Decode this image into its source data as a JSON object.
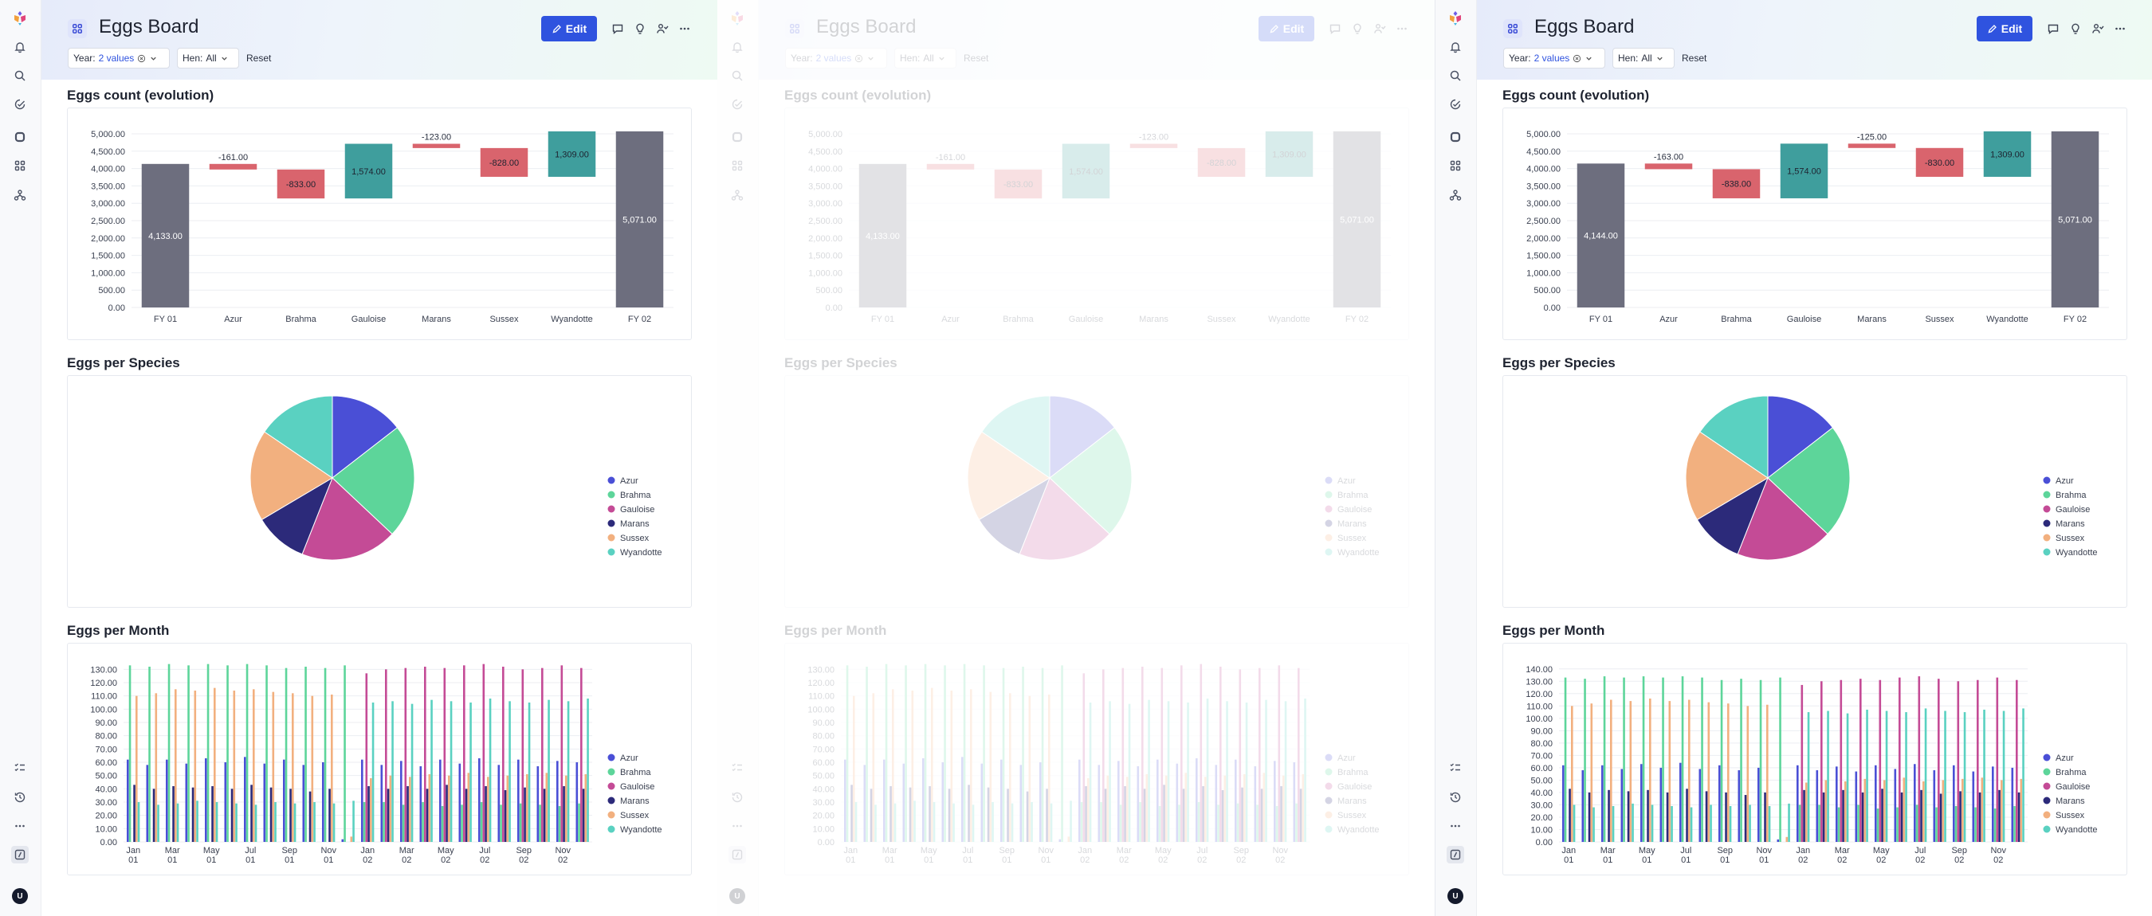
{
  "board": {
    "title": "Eggs Board",
    "edit_label": "Edit"
  },
  "filters": {
    "year_label": "Year:",
    "year_value": "2 values",
    "hen_label": "Hen:",
    "hen_value": "All",
    "reset_label": "Reset"
  },
  "sections": {
    "count_title": "Eggs count (evolution)",
    "species_title": "Eggs per Species",
    "month_title": "Eggs per Month"
  },
  "user_initial": "U",
  "colors": {
    "accent": "#2f53df",
    "total": "#6d6e7e",
    "increase": "#3f9e9d",
    "decrease": "#d9646d"
  },
  "icons": [
    "logo-icon",
    "bell-icon",
    "search-icon",
    "check-circle-icon",
    "square-icon",
    "apps-grid-icon",
    "org-chart-icon",
    "checklist-icon",
    "history-icon",
    "more-icon",
    "sidebar-toggle-icon",
    "pencil-icon",
    "comment-icon",
    "lightbulb-icon",
    "users-icon",
    "ellipsis-icon",
    "dashboard-icon",
    "clear-icon",
    "chevron-down-icon"
  ],
  "chart_data": [
    {
      "type": "bar",
      "variant": "waterfall",
      "panel": "left",
      "title": "Eggs count (evolution)",
      "categories": [
        "FY 01",
        "Azur",
        "Brahma",
        "Gauloise",
        "Marans",
        "Sussex",
        "Wyandotte",
        "FY 02"
      ],
      "values": [
        4133,
        -161,
        -833,
        1574,
        -123,
        -828,
        1309,
        5071
      ],
      "labels": [
        "4,133.00",
        "-161.00",
        "-833.00",
        "1,574.00",
        "-123.00",
        "-828.00",
        "1,309.00",
        "5,071.00"
      ],
      "yticks": [
        "0.00",
        "500.00",
        "1,000.00",
        "1,500.00",
        "2,000.00",
        "2,500.00",
        "3,000.00",
        "3,500.00",
        "4,000.00",
        "4,500.00",
        "5,000.00"
      ],
      "ylim": [
        0,
        5000
      ]
    },
    {
      "type": "bar",
      "variant": "waterfall",
      "panel": "right",
      "title": "Eggs count (evolution)",
      "categories": [
        "FY 01",
        "Azur",
        "Brahma",
        "Gauloise",
        "Marans",
        "Sussex",
        "Wyandotte",
        "FY 02"
      ],
      "values": [
        4144,
        -163,
        -838,
        1574,
        -125,
        -830,
        1309,
        5071
      ],
      "labels": [
        "4,144.00",
        "-163.00",
        "-838.00",
        "1,574.00",
        "-125.00",
        "-830.00",
        "1,309.00",
        "5,071.00"
      ],
      "yticks": [
        "0.00",
        "500.00",
        "1,000.00",
        "1,500.00",
        "2,000.00",
        "2,500.00",
        "3,000.00",
        "3,500.00",
        "4,000.00",
        "4,500.00",
        "5,000.00"
      ],
      "ylim": [
        0,
        5000
      ]
    },
    {
      "type": "pie",
      "title": "Eggs per Species",
      "legend": [
        "Azur",
        "Brahma",
        "Gauloise",
        "Marans",
        "Sussex",
        "Wyandotte"
      ],
      "values": [
        14.5,
        22.5,
        19,
        10.5,
        18,
        15.5
      ],
      "colors": [
        "#4a4fd6",
        "#5dd59a",
        "#c44b96",
        "#2c2a7a",
        "#f2b07f",
        "#5ad1c1"
      ]
    },
    {
      "type": "bar",
      "panel": "left",
      "title": "Eggs per Month",
      "categories": [
        "Jan 01",
        "Feb 01",
        "Mar 01",
        "Apr 01",
        "May 01",
        "Jun 01",
        "Jul 01",
        "Aug 01",
        "Sep 01",
        "Oct 01",
        "Nov 01",
        "Dec 01",
        "Jan 02",
        "Feb 02",
        "Mar 02",
        "Apr 02",
        "May 02",
        "Jun 02",
        "Jul 02",
        "Aug 02",
        "Sep 02",
        "Oct 02",
        "Nov 02",
        "Dec 02"
      ],
      "tick_labels": [
        "Jan 01",
        "Mar 01",
        "May 01",
        "Jul 01",
        "Sep 01",
        "Nov 01",
        "Jan 02",
        "Mar 02",
        "May 02",
        "Jul 02",
        "Sep 02",
        "Nov 02"
      ],
      "yticks": [
        "0.00",
        "10.00",
        "20.00",
        "30.00",
        "40.00",
        "50.00",
        "60.00",
        "70.00",
        "80.00",
        "90.00",
        "100.00",
        "110.00",
        "120.00",
        "130.00"
      ],
      "ylim": [
        0,
        135
      ],
      "series": [
        {
          "name": "Azur",
          "color": "#4a4fd6",
          "values": [
            62,
            58,
            62,
            59,
            63,
            60,
            64,
            59,
            62,
            58,
            60,
            2,
            62,
            58,
            61,
            57,
            62,
            59,
            63,
            58,
            62,
            57,
            61,
            60
          ]
        },
        {
          "name": "Brahma",
          "color": "#5dd59a",
          "values": [
            133,
            132,
            134,
            133,
            134,
            133,
            134,
            133,
            131,
            132,
            131,
            133,
            30,
            30,
            28,
            30,
            27,
            28,
            30,
            28,
            29,
            28,
            27,
            29
          ]
        },
        {
          "name": "Gauloise",
          "color": "#c44b96",
          "values": [
            0,
            0,
            0,
            0,
            0,
            0,
            0,
            0,
            0,
            0,
            0,
            0,
            127,
            130,
            131,
            132,
            131,
            133,
            134,
            132,
            130,
            131,
            133,
            131
          ]
        },
        {
          "name": "Marans",
          "color": "#2c2a7a",
          "values": [
            43,
            40,
            42,
            41,
            42,
            40,
            43,
            41,
            40,
            38,
            40,
            0,
            42,
            40,
            42,
            40,
            43,
            40,
            42,
            39,
            41,
            40,
            42,
            40
          ]
        },
        {
          "name": "Sussex",
          "color": "#f2b07f",
          "values": [
            110,
            112,
            115,
            114,
            116,
            114,
            115,
            113,
            112,
            110,
            111,
            4,
            48,
            50,
            49,
            51,
            50,
            52,
            49,
            50,
            51,
            52,
            50,
            51
          ]
        },
        {
          "name": "Wyandotte",
          "color": "#5ad1c1",
          "values": [
            30,
            28,
            29,
            31,
            30,
            29,
            28,
            30,
            29,
            30,
            29,
            31,
            105,
            106,
            104,
            107,
            106,
            105,
            108,
            106,
            105,
            107,
            106,
            108
          ]
        }
      ]
    },
    {
      "type": "bar",
      "panel": "right",
      "title": "Eggs per Month",
      "categories": [
        "Jan 01",
        "Feb 01",
        "Mar 01",
        "Apr 01",
        "May 01",
        "Jun 01",
        "Jul 01",
        "Aug 01",
        "Sep 01",
        "Oct 01",
        "Nov 01",
        "Dec 01",
        "Jan 02",
        "Feb 02",
        "Mar 02",
        "Apr 02",
        "May 02",
        "Jun 02",
        "Jul 02",
        "Aug 02",
        "Sep 02",
        "Oct 02",
        "Nov 02",
        "Dec 02"
      ],
      "tick_labels": [
        "Jan 01",
        "Mar 01",
        "May 01",
        "Jul 01",
        "Sep 01",
        "Nov 01",
        "Jan 02",
        "Mar 02",
        "May 02",
        "Jul 02",
        "Sep 02",
        "Nov 02"
      ],
      "yticks": [
        "0.00",
        "10.00",
        "20.00",
        "30.00",
        "40.00",
        "50.00",
        "60.00",
        "70.00",
        "80.00",
        "90.00",
        "100.00",
        "110.00",
        "120.00",
        "130.00",
        "140.00"
      ],
      "ylim": [
        0,
        145
      ],
      "series": [
        {
          "name": "Azur",
          "color": "#4a4fd6",
          "values": [
            62,
            58,
            62,
            59,
            63,
            60,
            64,
            59,
            62,
            58,
            60,
            2,
            62,
            58,
            61,
            57,
            62,
            59,
            63,
            58,
            62,
            57,
            61,
            60
          ]
        },
        {
          "name": "Brahma",
          "color": "#5dd59a",
          "values": [
            133,
            132,
            134,
            133,
            134,
            133,
            134,
            133,
            131,
            132,
            131,
            133,
            30,
            30,
            28,
            30,
            27,
            28,
            30,
            28,
            29,
            28,
            27,
            29
          ]
        },
        {
          "name": "Gauloise",
          "color": "#c44b96",
          "values": [
            0,
            0,
            0,
            0,
            0,
            0,
            0,
            0,
            0,
            0,
            0,
            0,
            127,
            130,
            131,
            132,
            131,
            133,
            134,
            132,
            130,
            131,
            133,
            131
          ]
        },
        {
          "name": "Marans",
          "color": "#2c2a7a",
          "values": [
            43,
            40,
            42,
            41,
            42,
            40,
            43,
            41,
            40,
            38,
            40,
            0,
            42,
            40,
            42,
            40,
            43,
            40,
            42,
            39,
            41,
            40,
            42,
            40
          ]
        },
        {
          "name": "Sussex",
          "color": "#f2b07f",
          "values": [
            110,
            112,
            115,
            114,
            116,
            114,
            115,
            113,
            112,
            110,
            111,
            4,
            48,
            50,
            49,
            51,
            50,
            52,
            49,
            50,
            51,
            52,
            50,
            51
          ]
        },
        {
          "name": "Wyandotte",
          "color": "#5ad1c1",
          "values": [
            30,
            28,
            29,
            31,
            30,
            29,
            28,
            30,
            29,
            30,
            29,
            31,
            105,
            106,
            104,
            107,
            106,
            105,
            108,
            106,
            105,
            107,
            106,
            108
          ]
        }
      ]
    }
  ]
}
